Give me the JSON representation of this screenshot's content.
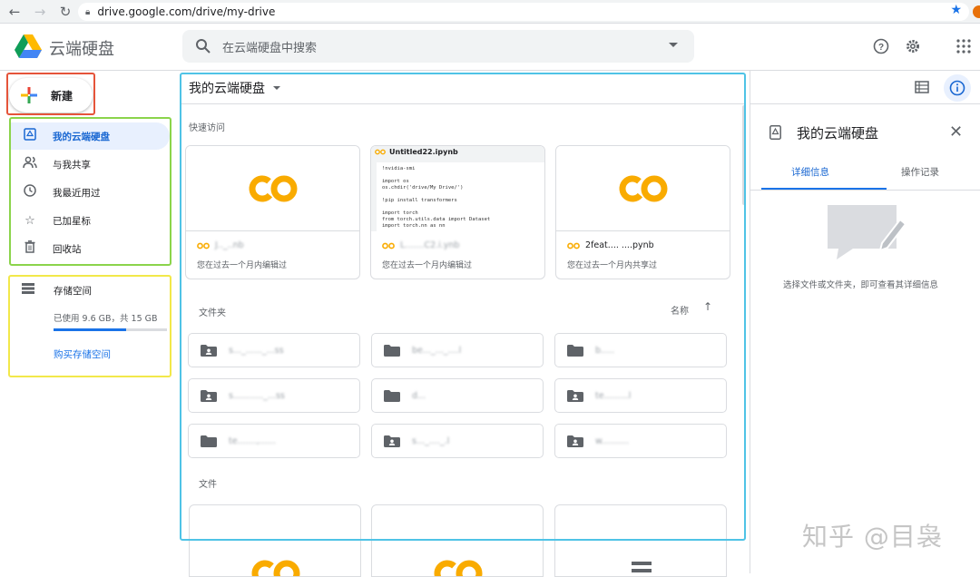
{
  "browser": {
    "url": "drive.google.com/drive/my-drive",
    "back_icon": "back-arrow-icon",
    "forward_icon": "forward-arrow-icon",
    "reload_icon": "reload-icon"
  },
  "header": {
    "app_title": "云端硬盘",
    "search_placeholder": "在云端硬盘中搜索"
  },
  "sidebar": {
    "new_button": "新建",
    "items": [
      {
        "label": "我的云端硬盘",
        "icon": "my-drive-icon",
        "active": true
      },
      {
        "label": "与我共享",
        "icon": "shared-people-icon",
        "active": false
      },
      {
        "label": "我最近用过",
        "icon": "clock-icon",
        "active": false
      },
      {
        "label": "已加星标",
        "icon": "star-icon",
        "active": false
      },
      {
        "label": "回收站",
        "icon": "trash-icon",
        "active": false
      }
    ],
    "storage": {
      "label": "存储空间",
      "used_text": "已使用 9.6 GB，共 15 GB",
      "used_fraction": 0.64,
      "buy_link": "购买存储空间"
    }
  },
  "main": {
    "title": "我的云端硬盘",
    "quick_access_label": "快速访问",
    "quick_access": [
      {
        "name": "J.._..nb",
        "subtitle": "您在过去一个月内编辑过",
        "thumb": "colab"
      },
      {
        "name": "Untitled22.ipynb",
        "subtitle": "您在过去一个月内编辑过",
        "thumb": "notebook",
        "blurred_name": "L.......C2.i.ynb",
        "code": "!nvidia-smi\n\nimport os\nos.chdir('drive/My Drive/')\n\n!pip install transformers\n\nimport torch\nfrom torch.utils.data import Dataset\nimport torch.nn as nn"
      },
      {
        "name": "2feat.... ....pynb",
        "subtitle": "您在过去一个月内共享过",
        "thumb": "colab"
      }
    ],
    "folders_label": "文件夹",
    "sort_label": "名称",
    "folders": [
      {
        "name": "s..._......_...ss",
        "shared": true
      },
      {
        "name": "be..._..._....l",
        "shared": false
      },
      {
        "name": "b.....",
        "shared": false
      },
      {
        "name": "s..........._...ss",
        "shared": true
      },
      {
        "name": "d...",
        "shared": false
      },
      {
        "name": "te.........l",
        "shared": true
      },
      {
        "name": "te.......,......",
        "shared": false
      },
      {
        "name": "s..._...._.l",
        "shared": true
      },
      {
        "name": "w..........",
        "shared": true
      }
    ],
    "files_label": "文件"
  },
  "details_panel": {
    "title": "我的云端硬盘",
    "tabs": [
      "详细信息",
      "操作记录"
    ],
    "active_tab": 0,
    "empty_message": "选择文件或文件夹，即可查看其详细信息"
  },
  "watermark": "知乎 @目袅",
  "colors": {
    "accent": "#1a73e8",
    "active_bg": "#e8f0fe",
    "highlight_red": "#e5543a",
    "highlight_green": "#8bd44b",
    "highlight_yellow": "#f2e84a",
    "highlight_blue": "#4fc3e6",
    "colab_orange": "#f9ab00"
  }
}
